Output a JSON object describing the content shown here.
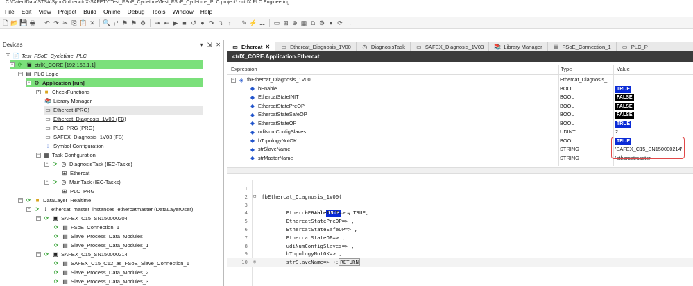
{
  "window": {
    "title": "C:\\Daten\\Data\\STSA\\SyncOrdner\\ctrlX-SAFETY\\Test_FSoE_Cycletime\\Test_FSoE_Cycletime_PLC.project* - ctrlX PLC Engineering"
  },
  "menu": [
    "File",
    "Edit",
    "View",
    "Project",
    "Build",
    "Online",
    "Debug",
    "Tools",
    "Window",
    "Help"
  ],
  "devices_panel": {
    "title": "Devices",
    "controls": [
      "▾",
      "⇲",
      "✕"
    ],
    "tree": [
      {
        "label": "Test_FSoE_Cycletime_PLC",
        "style": "italic"
      },
      {
        "label": "ctrlX_CORE  [192.168.1.1]",
        "highlight": "green"
      },
      {
        "label": "PLC Logic"
      },
      {
        "label": "Application [run]",
        "highlight": "green",
        "bold": true
      },
      {
        "label": "CheckFunctions"
      },
      {
        "label": "Library Manager"
      },
      {
        "label": "Ethercat (PRG)",
        "highlight": "gray"
      },
      {
        "label": "Ethercat_Diagnosis_1V00 (FB)",
        "underline": true
      },
      {
        "label": "PLC_PRG (PRG)"
      },
      {
        "label": "SAFEX_Diagnosis_1V03 (FB)",
        "underline": true
      },
      {
        "label": "Symbol Configuration"
      },
      {
        "label": "Task Configuration"
      },
      {
        "label": "DiagnosisTask (IEC-Tasks)"
      },
      {
        "label": "Ethercat"
      },
      {
        "label": "MainTask (IEC-Tasks)"
      },
      {
        "label": "PLC_PRG"
      },
      {
        "label": "DataLayer_Realtime"
      },
      {
        "label": "ethercat_master_instances_ethercatmaster (DataLayerUser)"
      },
      {
        "label": "SAFEX_C15_SN150000204"
      },
      {
        "label": "FSoE_Connection_1"
      },
      {
        "label": "Slave_Process_Data_Modules"
      },
      {
        "label": "Slave_Process_Data_Modules_1"
      },
      {
        "label": "SAFEX_C15_SN150000214"
      },
      {
        "label": "SAFEX_C15_C12_as_FSoE_Slave_Connection_1"
      },
      {
        "label": "Slave_Process_Data_Modules_2"
      },
      {
        "label": "Slave_Process_Data_Modules_3"
      }
    ]
  },
  "tabs": [
    {
      "label": "Ethercat",
      "active": true,
      "closable": true
    },
    {
      "label": "Ethercat_Diagnosis_1V00"
    },
    {
      "label": "DiagnosisTask"
    },
    {
      "label": "SAFEX_Diagnosis_1V03"
    },
    {
      "label": "Library Manager"
    },
    {
      "label": "FSoE_Connection_1"
    },
    {
      "label": "PLC_P"
    }
  ],
  "object_title": "ctrlX_CORE.Application.Ethercat",
  "watch": {
    "headers": {
      "expression": "Expression",
      "type": "Type",
      "value": "Value"
    },
    "rows": [
      {
        "expr": "fbEthercat_Diagnosis_1V00",
        "type": "Ethercat_Diagnosis_...",
        "value": "",
        "badge": "",
        "root": true
      },
      {
        "expr": "bEnable",
        "type": "BOOL",
        "value": "TRUE",
        "badge": "blue"
      },
      {
        "expr": "EthercatStateINIT",
        "type": "BOOL",
        "value": "FALSE",
        "badge": "black"
      },
      {
        "expr": "EthercatStatePreOP",
        "type": "BOOL",
        "value": "FALSE",
        "badge": "black"
      },
      {
        "expr": "EthercatStateSafeOP",
        "type": "BOOL",
        "value": "FALSE",
        "badge": "black"
      },
      {
        "expr": "EthercatStateOP",
        "type": "BOOL",
        "value": "TRUE",
        "badge": "blue"
      },
      {
        "expr": "udiNumConfigSlaves",
        "type": "UDINT",
        "value": "2",
        "badge": ""
      },
      {
        "expr": "bTopologyNotOK",
        "type": "BOOL",
        "value": "TRUE",
        "badge": "blue"
      },
      {
        "expr": "strSlaveName",
        "type": "STRING",
        "value": "'SAFEX_C15_SN150000214'",
        "badge": ""
      },
      {
        "expr": "strMasterName",
        "type": "STRING",
        "value": "'ethercatmaster'",
        "badge": ""
      }
    ]
  },
  "code": {
    "lines": [
      {
        "n": "1",
        "text": ""
      },
      {
        "n": "2",
        "text": "fbEthercat_Diagnosis_1V00("
      },
      {
        "n": "3",
        "text": "        bEnable",
        "inline": "TRUE",
        "after": " := TRUE,"
      },
      {
        "n": "4",
        "text": "        EthercatStateINIT=> ,"
      },
      {
        "n": "5",
        "text": "        EthercatStatePreOP=> ,"
      },
      {
        "n": "6",
        "text": "        EthercatStateSafeOP=> ,"
      },
      {
        "n": "7",
        "text": "        EthercatStateOP=> ,"
      },
      {
        "n": "8",
        "text": "        udiNumConfigSlaves=> ,"
      },
      {
        "n": "9",
        "text": "        bTopologyNotOK=> ,"
      },
      {
        "n": "10",
        "text": "        strSlaveName=> );",
        "ret": "RETURN"
      }
    ]
  },
  "colors": {
    "accent_green": "#7be07b",
    "title_bar": "#3b3b3b",
    "true_badge": "#0a2bd6",
    "false_badge": "#000000",
    "highlight_box": "#e04848"
  }
}
